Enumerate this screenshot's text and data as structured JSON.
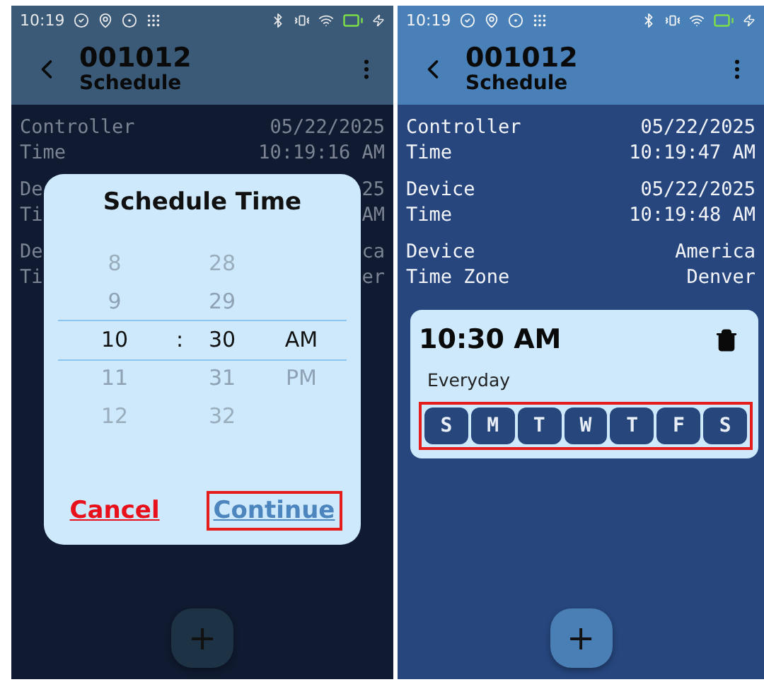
{
  "phones": [
    {
      "dimmed": true,
      "status_bar": {
        "time": "10:19"
      },
      "header": {
        "title": "001012",
        "subtitle": "Schedule"
      },
      "info_rows": [
        {
          "label_1": "Controller",
          "label_2": "Time",
          "value_1": "05/22/2025",
          "value_2": "10:19:16 AM"
        },
        {
          "label_1": "De",
          "label_2": "Ti",
          "value_1": "25",
          "value_2": "AM"
        },
        {
          "label_1": "De",
          "label_2": "Ti",
          "value_1": "ca",
          "value_2": "er"
        }
      ],
      "dialog": {
        "title": "Schedule Time",
        "separator": ":",
        "hours": [
          {
            "label": "8",
            "selected": false
          },
          {
            "label": "9",
            "selected": false
          },
          {
            "label": "10",
            "selected": true
          },
          {
            "label": "11",
            "selected": false
          },
          {
            "label": "12",
            "selected": false
          }
        ],
        "minutes": [
          {
            "label": "28",
            "selected": false
          },
          {
            "label": "29",
            "selected": false
          },
          {
            "label": "30",
            "selected": true
          },
          {
            "label": "31",
            "selected": false
          },
          {
            "label": "32",
            "selected": false
          }
        ],
        "periods": [
          {
            "label": "AM",
            "selected": true
          },
          {
            "label": "PM",
            "selected": false
          }
        ],
        "buttons": [
          {
            "label": "Cancel",
            "kind": "cancel",
            "highlighted": false
          },
          {
            "label": "Continue",
            "kind": "confirm",
            "highlighted": true
          }
        ]
      },
      "fab": {
        "label": "+"
      }
    },
    {
      "dimmed": false,
      "status_bar": {
        "time": "10:19"
      },
      "header": {
        "title": "001012",
        "subtitle": "Schedule"
      },
      "info_rows": [
        {
          "label_1": "Controller",
          "label_2": "Time",
          "value_1": "05/22/2025",
          "value_2": "10:19:47 AM"
        },
        {
          "label_1": "Device",
          "label_2": "Time",
          "value_1": "05/22/2025",
          "value_2": "10:19:48 AM"
        },
        {
          "label_1": "Device",
          "label_2": "Time Zone",
          "value_1": "America",
          "value_2": "Denver"
        }
      ],
      "schedules": [
        {
          "time": "10:30 AM",
          "repeat": "Everyday",
          "highlighted": true,
          "days": [
            {
              "label": "S",
              "selected": true
            },
            {
              "label": "M",
              "selected": true
            },
            {
              "label": "T",
              "selected": true
            },
            {
              "label": "W",
              "selected": true
            },
            {
              "label": "T",
              "selected": true
            },
            {
              "label": "F",
              "selected": true
            },
            {
              "label": "S",
              "selected": true
            }
          ]
        }
      ],
      "fab": {
        "label": "+"
      }
    }
  ]
}
